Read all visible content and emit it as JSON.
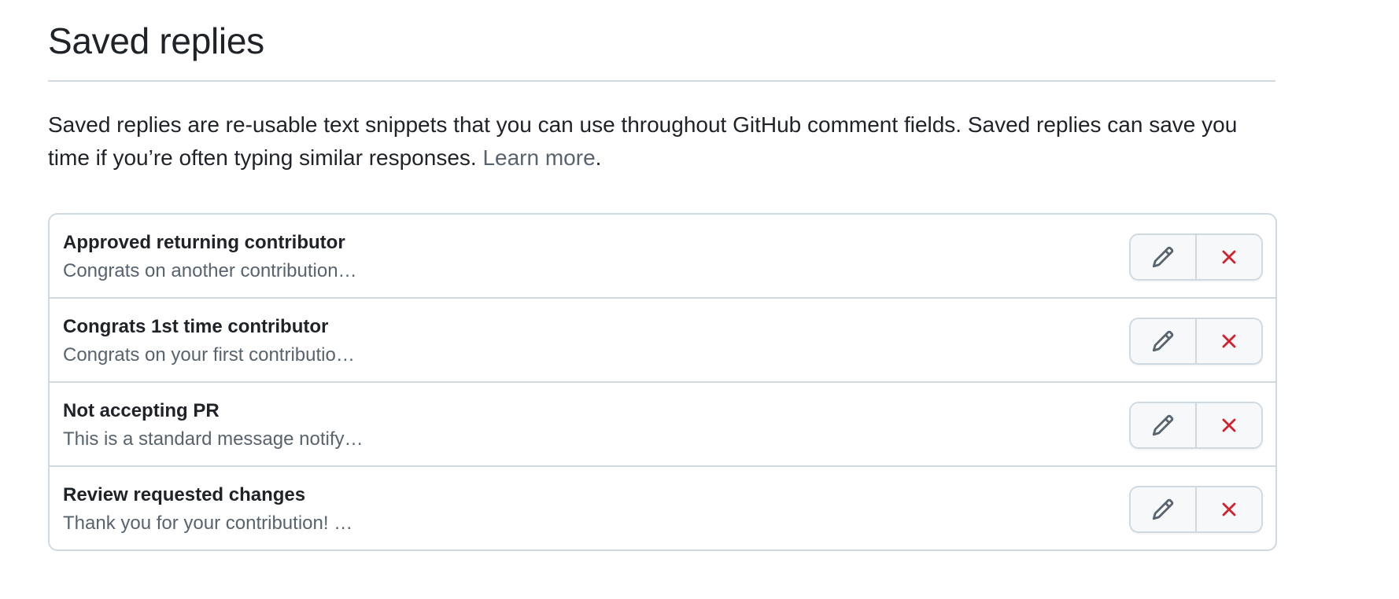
{
  "header": {
    "title": "Saved replies"
  },
  "intro": {
    "text": "Saved replies are re-usable text snippets that you can use throughout GitHub comment fields. Saved replies can save you time if you’re often typing similar responses.",
    "link_label": "Learn more",
    "trailing": "."
  },
  "saved_replies": [
    {
      "title": "Approved returning contributor",
      "preview": "Congrats on another contribution…"
    },
    {
      "title": "Congrats 1st time contributor",
      "preview": "Congrats on your first contributio…"
    },
    {
      "title": "Not accepting PR",
      "preview": "This is a standard message notify…"
    },
    {
      "title": "Review requested changes",
      "preview": "Thank you for your contribution! …"
    }
  ],
  "icons": {
    "edit": "pencil-icon",
    "delete": "x-icon"
  },
  "colors": {
    "text": "#1f2328",
    "muted": "#59636e",
    "border": "#d1d9e0",
    "button_bg": "#f6f8fa",
    "danger": "#cf222e"
  }
}
